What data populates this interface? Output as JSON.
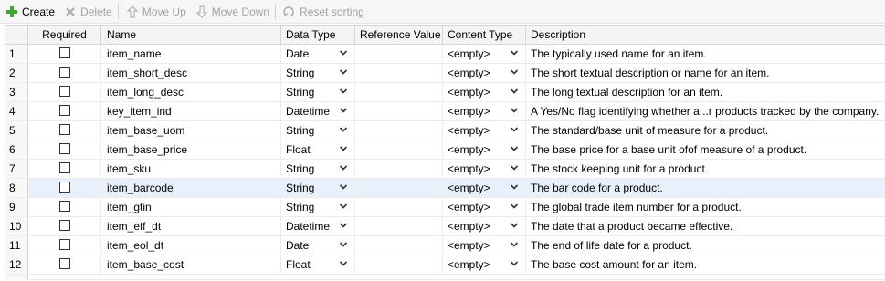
{
  "toolbar": {
    "create": "Create",
    "delete": "Delete",
    "move_up": "Move Up",
    "move_down": "Move Down",
    "reset_sorting": "Reset sorting"
  },
  "columns": {
    "num": "",
    "required": "Required",
    "name": "Name",
    "data_type": "Data Type",
    "reference_value": "Reference Value",
    "content_type": "Content Type",
    "description": "Description"
  },
  "rows": [
    {
      "num": "1",
      "name": "item_name",
      "data_type": "Date",
      "reference_value": "",
      "content_type": "<empty>",
      "description": "The typically used name for an item."
    },
    {
      "num": "2",
      "name": "item_short_desc",
      "data_type": "String",
      "reference_value": "",
      "content_type": "<empty>",
      "description": "The short textual description or name for an item."
    },
    {
      "num": "3",
      "name": "item_long_desc",
      "data_type": "String",
      "reference_value": "",
      "content_type": "<empty>",
      "description": "The long textual description for an item."
    },
    {
      "num": "4",
      "name": "key_item_ind",
      "data_type": "Datetime",
      "reference_value": "",
      "content_type": "<empty>",
      "description": "A Yes/No flag identifying whether a...r products tracked by the company."
    },
    {
      "num": "5",
      "name": "item_base_uom",
      "data_type": "String",
      "reference_value": "",
      "content_type": "<empty>",
      "description": "The standard/base unit of measure for a product."
    },
    {
      "num": "6",
      "name": "item_base_price",
      "data_type": "Float",
      "reference_value": "",
      "content_type": "<empty>",
      "description": "The base price for a base unit ofof measure of a product."
    },
    {
      "num": "7",
      "name": "item_sku",
      "data_type": "String",
      "reference_value": "",
      "content_type": "<empty>",
      "description": "The stock keeping unit for a product."
    },
    {
      "num": "8",
      "name": "item_barcode",
      "data_type": "String",
      "reference_value": "",
      "content_type": "<empty>",
      "description": "The bar code for a product."
    },
    {
      "num": "9",
      "name": "item_gtin",
      "data_type": "String",
      "reference_value": "",
      "content_type": "<empty>",
      "description": "The global trade item number for a product."
    },
    {
      "num": "10",
      "name": "item_eff_dt",
      "data_type": "Datetime",
      "reference_value": "",
      "content_type": "<empty>",
      "description": "The date that a product became effective."
    },
    {
      "num": "11",
      "name": "item_eol_dt",
      "data_type": "Date",
      "reference_value": "",
      "content_type": "<empty>",
      "description": "The end of life date for a product."
    },
    {
      "num": "12",
      "name": "item_base_cost",
      "data_type": "Float",
      "reference_value": "",
      "content_type": "<empty>",
      "description": "The base cost amount for an item."
    }
  ],
  "selected_row": 8,
  "colors": {
    "accent_plus": "#3fa535",
    "selection": "#e8f1fb",
    "disabled_text": "#a3a3a3"
  }
}
